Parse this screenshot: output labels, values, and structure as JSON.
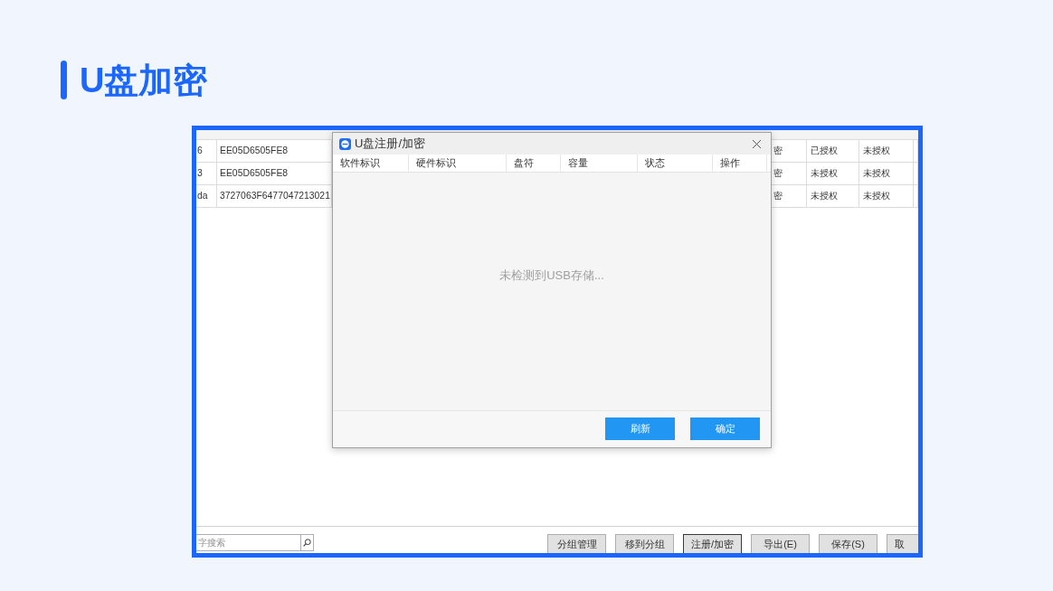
{
  "slide": {
    "title": "U盘加密"
  },
  "app": {
    "table": {
      "rows": [
        [
          "6",
          "EE05D6505FE8",
          "密",
          "已授权",
          "未授权"
        ],
        [
          "3",
          "EE05D6505FE8",
          "密",
          "未授权",
          "未授权"
        ],
        [
          "da",
          "3727063F6477047213021",
          "密",
          "未授权",
          "未授权"
        ]
      ]
    },
    "search": {
      "placeholder": "字搜索"
    },
    "buttons": [
      {
        "label": "分组管理",
        "focused": false
      },
      {
        "label": "移到分组",
        "focused": false
      },
      {
        "label": "注册/加密",
        "focused": true
      },
      {
        "label": "导出(E)",
        "focused": false
      },
      {
        "label": "保存(S)",
        "focused": false
      },
      {
        "label": "取",
        "focused": false
      }
    ]
  },
  "dialog": {
    "title": "U盘注册/加密",
    "columns": [
      "软件标识",
      "硬件标识",
      "盘符",
      "容量",
      "状态",
      "操作"
    ],
    "empty_message": "未检测到USB存储...",
    "buttons": [
      "刷新",
      "确定"
    ]
  }
}
